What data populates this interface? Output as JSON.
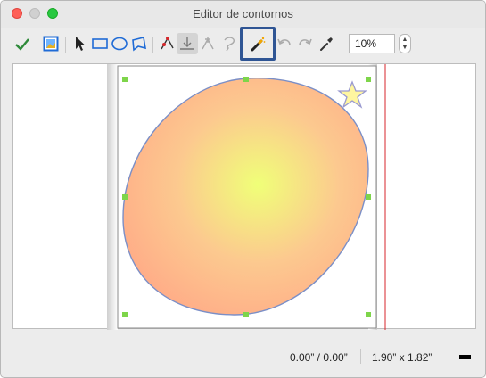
{
  "window": {
    "title": "Editor de contornos"
  },
  "toolbar": {
    "zoom_value": "10%",
    "tools": [
      "check-icon",
      "image-icon",
      "select-arrow-icon",
      "rectangle-icon",
      "ellipse-icon",
      "polygon-icon",
      "add-point-icon",
      "delete-point-icon",
      "move-point-icon",
      "lasso-icon",
      "magic-wand-icon",
      "undo-icon",
      "redo-icon",
      "eyedropper-icon"
    ]
  },
  "status": {
    "position": "0.00” / 0.00”",
    "size": "1.90” x 1.82”"
  },
  "colors": {
    "accent_highlight": "#2f5594",
    "guide_line": "#d7262b",
    "handle": "#7ed54a"
  }
}
